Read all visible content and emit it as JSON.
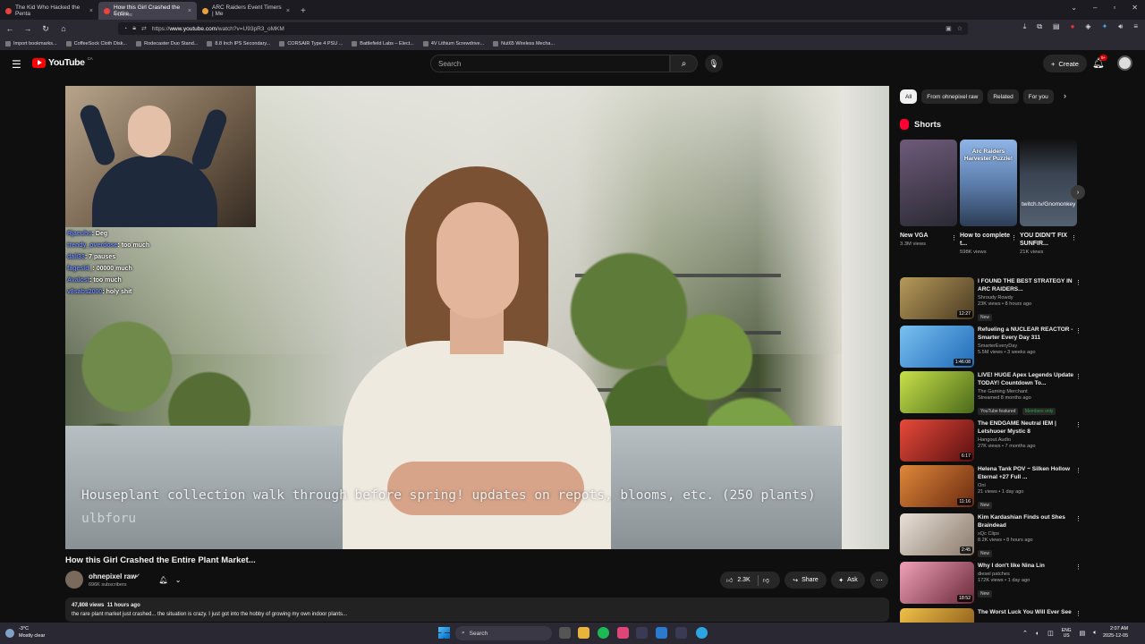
{
  "browser": {
    "tabs": [
      {
        "title": "The Kid Who Hacked the Penta",
        "favicon": "youtube-icon"
      },
      {
        "title": "How this Girl Crashed the Entire",
        "subtitle": "PLAYING",
        "favicon": "youtube-icon",
        "active": true
      },
      {
        "title": "ARC Raiders Event Timers | Me",
        "favicon": "arc-icon"
      }
    ],
    "url_prefix": "https://",
    "url_host": "www.youtube.com",
    "url_path": "/watch?v=U93pR3_oMKM",
    "bookmarks": [
      "Import bookmarks...",
      "CoffeeSock Cloth Disk...",
      "Rodecaster Duo Stand...",
      "8.8 Inch IPS Secondary...",
      "CORSAIR Type 4 PSU ...",
      "Battlefield Labs – Elect...",
      "4V Lithium Screwdrive...",
      "Nut65 Wireless Mecha..."
    ]
  },
  "header": {
    "logo_text": "YouTube",
    "logo_region": "CA",
    "search_placeholder": "Search",
    "create_label": "Create",
    "notification_count": "9+"
  },
  "video": {
    "chat": [
      {
        "user": "Rjaeuho",
        "msg": "Deg"
      },
      {
        "user": "trendy_overdose",
        "msg": "too much"
      },
      {
        "user": "dali33",
        "msg": "7 pauses"
      },
      {
        "user": "fagesld_",
        "msg": "00000 much"
      },
      {
        "user": "Avalost",
        "msg": "too much"
      },
      {
        "user": "v8sabs2000",
        "msg": "holy shit"
      }
    ],
    "subtitle_line1": "Houseplant collection walk through before spring! updates on repots, blooms, etc. (250 plants)",
    "subtitle_line2": "ulbforu",
    "title": "How this Girl Crashed the Entire Plant Market...",
    "channel_name": "ohnepixel raw",
    "subscribers": "696K subscribers",
    "likes": "2.3K",
    "share_label": "Share",
    "ask_label": "Ask",
    "views": "47,808 views",
    "age": "11 hours ago",
    "description": "the rare plant market just crashed... the situation is crazy. I just got into the hobby of growing my own indoor plants..."
  },
  "sidebar": {
    "chips": [
      "All",
      "From ohnepixel raw",
      "Related",
      "For you"
    ],
    "shorts_title": "Shorts",
    "shorts": [
      {
        "title": "New VGA",
        "views": "3.3M views",
        "overlay": "",
        "overlay_bottom": "",
        "color": "#6e5a7a"
      },
      {
        "title": "How to complete t...",
        "views": "598K views",
        "overlay": "Arc Raiders Harvester Puzzle!",
        "overlay_bottom": "",
        "color": "#5d7fae"
      },
      {
        "title": "YOU DIDN'T FIX SUNFIR...",
        "views": "21K views",
        "overlay": "",
        "overlay_bottom": "twitch.tv/Gnomonkey",
        "color": "#3a4452"
      }
    ],
    "related": [
      {
        "title": "I FOUND THE BEST STRATEGY IN ARC RAIDERS...",
        "channel": "Shroudy Rowdy",
        "meta": "23K views • 8 hours ago",
        "badge": "New",
        "duration": "12:27",
        "color": "#7a6a3a"
      },
      {
        "title": "Refueling a NUCLEAR REACTOR - Smarter Every Day 311",
        "channel": "SmarterEveryDay",
        "meta": "5.5M views • 3 weeks ago",
        "badge": "",
        "duration": "1:46:08",
        "color": "#3b8fd6"
      },
      {
        "title": "LIVE! HUGE Apex Legends Update TODAY! Countdown To...",
        "channel": "The Gaming Merchant",
        "meta": "Streamed 8 months ago",
        "badge": "YouTube featured",
        "badge2": "Members only",
        "duration": "",
        "color": "#a8c83a"
      },
      {
        "title": "The ENDGAME Neutral IEM | Letshuoer Mystic 8",
        "channel": "Hangout.Audio",
        "meta": "27K views • 7 months ago",
        "badge": "",
        "duration": "6:17",
        "color": "#c23a3a"
      },
      {
        "title": "Helena Tank POV ~ Silken Hollow Eternal +27 Full ...",
        "channel": "Oni",
        "meta": "21 views • 1 day ago",
        "badge": "New",
        "duration": "11:16",
        "color": "#b04a2a"
      },
      {
        "title": "Kim Kardashian Finds out Shes Braindead",
        "channel": "xQc Clips",
        "meta": "8.2K views • 8 hours ago",
        "badge": "New",
        "duration": "2:45",
        "color": "#c8c0b8"
      },
      {
        "title": "Why I don't like Nina Lin",
        "channel": "diesel patches",
        "meta": "172K views • 1 day ago",
        "badge": "New",
        "duration": "18:52",
        "color": "#c0607a"
      },
      {
        "title": "The Worst Luck You Will Ever See",
        "channel": "",
        "meta": "",
        "badge": "",
        "duration": "",
        "color": "#d89a2a"
      }
    ]
  },
  "taskbar": {
    "temperature": "-3°C",
    "weather": "Mostly clear",
    "search_label": "Search",
    "lang1": "ENG",
    "lang2": "US",
    "time": "2:07 AM",
    "date": "2025-12-05"
  }
}
